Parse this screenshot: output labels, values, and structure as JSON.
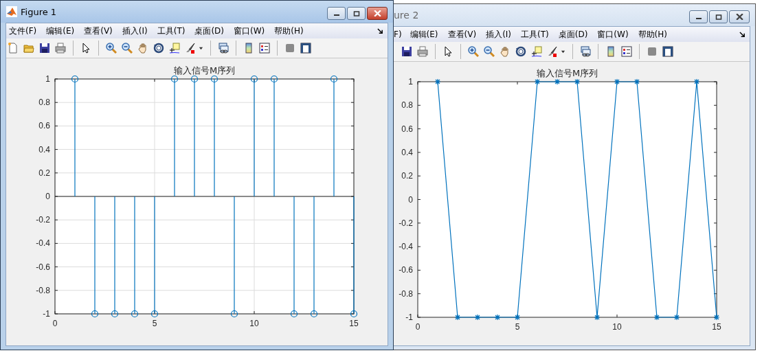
{
  "windows": [
    {
      "title": "Figure 1",
      "active": true,
      "menu": [
        "文件(F)",
        "编辑(E)",
        "查看(V)",
        "插入(I)",
        "工具(T)",
        "桌面(D)",
        "窗口(W)",
        "帮助(H)"
      ],
      "chart_data": {
        "grid": true,
        "type": "scatter",
        "title": "输入信号M序列",
        "x": [
          1,
          2,
          3,
          4,
          5,
          6,
          7,
          8,
          9,
          10,
          11,
          12,
          13,
          14,
          15
        ],
        "values": [
          1,
          -1,
          -1,
          -1,
          -1,
          1,
          1,
          1,
          -1,
          1,
          1,
          -1,
          -1,
          1,
          -1
        ],
        "xlim": [
          0,
          15
        ],
        "ylim": [
          -1,
          1
        ],
        "xticks": [
          0,
          5,
          10,
          15
        ],
        "yticks": [
          -1,
          -0.8,
          -0.6,
          -0.4,
          -0.2,
          0,
          0.2,
          0.4,
          0.6,
          0.8,
          1
        ]
      }
    },
    {
      "title": "ure 2",
      "active": false,
      "menu": [
        "F)",
        "编辑(E)",
        "查看(V)",
        "插入(I)",
        "工具(T)",
        "桌面(D)",
        "窗口(W)",
        "帮助(H)"
      ],
      "chart_data": {
        "grid": false,
        "type": "line",
        "title": "输入信号M序列",
        "x": [
          1,
          2,
          3,
          4,
          5,
          6,
          7,
          8,
          9,
          10,
          11,
          12,
          13,
          14,
          15
        ],
        "values": [
          1,
          -1,
          -1,
          -1,
          -1,
          1,
          1,
          1,
          -1,
          1,
          1,
          -1,
          -1,
          1,
          -1
        ],
        "xlim": [
          0,
          15
        ],
        "ylim": [
          -1,
          1
        ],
        "xticks": [
          0,
          5,
          10,
          15
        ],
        "yticks": [
          -1,
          -0.8,
          -0.6,
          -0.4,
          -0.2,
          0,
          0.2,
          0.4,
          0.6,
          0.8,
          1
        ]
      }
    }
  ]
}
